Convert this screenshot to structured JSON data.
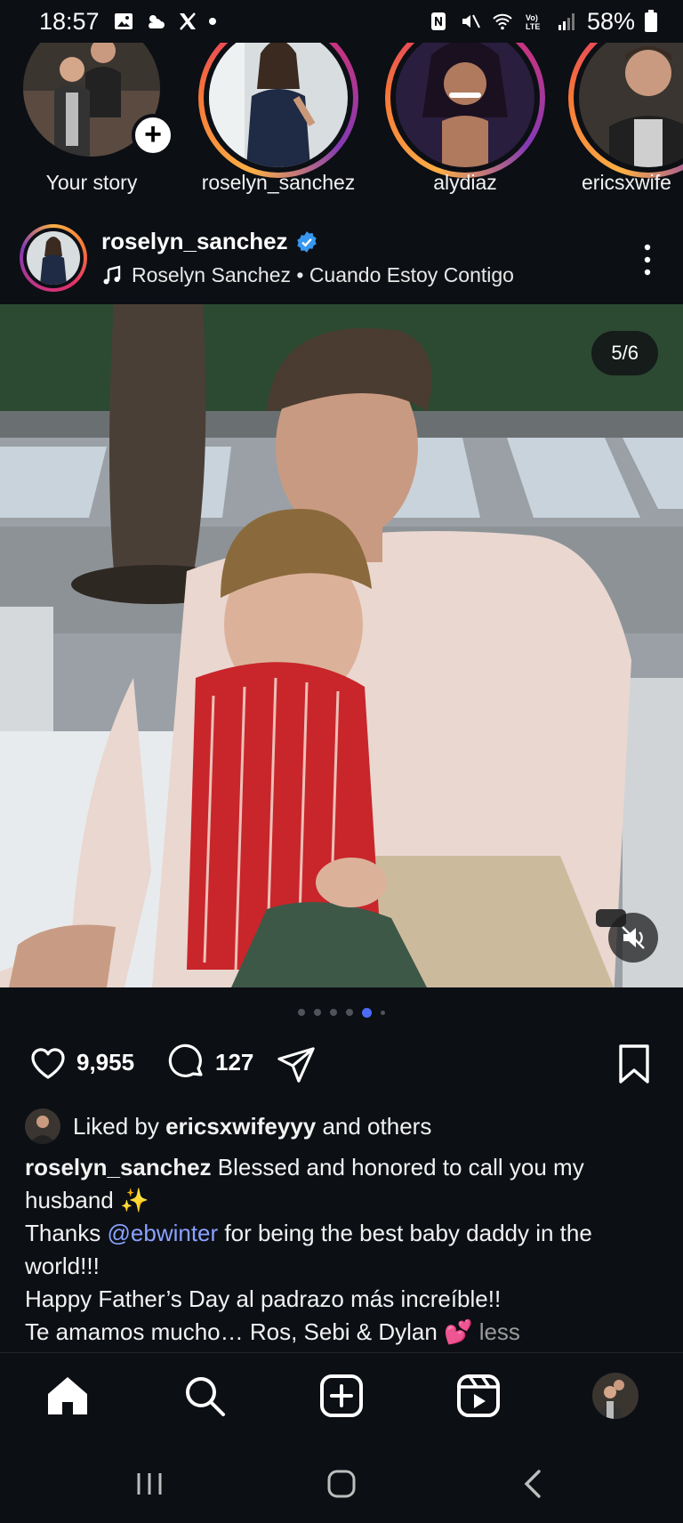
{
  "status_bar": {
    "time": "18:57",
    "battery": "58%",
    "icons": [
      "gallery-icon",
      "weather-icon",
      "x-icon",
      "dot-icon",
      "nfc-icon",
      "mute-icon",
      "wifi-icon",
      "volte-icon",
      "signal-icon",
      "battery-icon"
    ]
  },
  "stories": [
    {
      "label": "Your story",
      "own": true
    },
    {
      "label": "roselyn_sanchez",
      "own": false
    },
    {
      "label": "alydiaz",
      "own": false
    },
    {
      "label": "ericsxwife",
      "own": false
    }
  ],
  "post": {
    "username": "roselyn_sanchez",
    "verified": true,
    "audio": "Roselyn Sanchez • Cuando Estoy Contigo",
    "page_counter": "5/6",
    "current_slide": 5,
    "total_slides": 6,
    "likes": "9,955",
    "comments": "127",
    "liked_by_prefix": "Liked by",
    "liked_by_user": "ericsxwifeyyy",
    "liked_by_suffix": "and others",
    "caption": {
      "author": "roselyn_sanchez",
      "line1": "Blessed and honored to call you my husband ✨",
      "thanks_prefix": "Thanks",
      "mention": "@ebwinter",
      "thanks_suffix": "for being the best baby daddy in the world!!!",
      "line3": "Happy Father’s Day al padrazo más increíble!!",
      "line4": "Te amamos mucho… Ros, Sebi & Dylan 💕",
      "less": "less"
    }
  },
  "nav": {
    "items": [
      "home-icon",
      "search-icon",
      "create-icon",
      "reels-icon",
      "profile-avatar"
    ]
  },
  "colors": {
    "background": "#0c0f14",
    "accent_blue": "#4a6cf7",
    "mention": "#8aa2ff",
    "verified": "#3897f0"
  }
}
